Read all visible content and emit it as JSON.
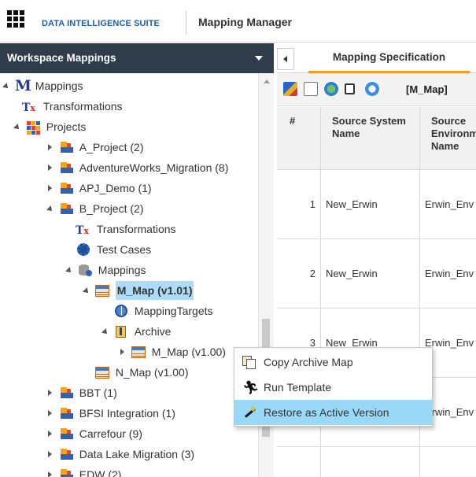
{
  "header": {
    "brand": "DATA INTELLIGENCE SUITE",
    "title": "Mapping Manager",
    "icons": {
      "app_menu": "waffle-grid-icon"
    }
  },
  "left_panel": {
    "title": "Workspace Mappings",
    "tree": [
      {
        "label": "Mappings",
        "icon": "mappings-root-icon",
        "state": "expanded"
      },
      {
        "label": "Transformations",
        "icon": "transformations-icon",
        "state": "leaf"
      },
      {
        "label": "Projects",
        "icon": "projects-grid-icon",
        "state": "expanded"
      },
      {
        "label": "A_Project (2)",
        "icon": "project-icon",
        "state": "collapsed"
      },
      {
        "label": "AdventureWorks_Migration (8)",
        "icon": "project-icon",
        "state": "collapsed"
      },
      {
        "label": "APJ_Demo (1)",
        "icon": "project-icon",
        "state": "collapsed"
      },
      {
        "label": "B_Project (2)",
        "icon": "project-icon",
        "state": "expanded"
      },
      {
        "label": "Transformations",
        "icon": "transformations-icon",
        "state": "leaf"
      },
      {
        "label": "Test Cases",
        "icon": "test-cases-icon",
        "state": "leaf"
      },
      {
        "label": "Mappings",
        "icon": "mappings-db-icon",
        "state": "expanded"
      },
      {
        "label": "M_Map (v1.01)",
        "icon": "map-table-icon",
        "state": "expanded",
        "selected": true
      },
      {
        "label": "MappingTargets",
        "icon": "mapping-targets-icon",
        "state": "leaf"
      },
      {
        "label": "Archive",
        "icon": "archive-icon",
        "state": "expanded"
      },
      {
        "label": "M_Map (v1.00)",
        "icon": "map-table-icon",
        "state": "collapsed"
      },
      {
        "label": "N_Map (v1.00)",
        "icon": "map-table-icon",
        "state": "leaf"
      },
      {
        "label": "BBT (1)",
        "icon": "project-icon",
        "state": "collapsed"
      },
      {
        "label": "BFSI Integration (1)",
        "icon": "project-icon",
        "state": "collapsed"
      },
      {
        "label": "Carrefour (9)",
        "icon": "project-icon",
        "state": "collapsed"
      },
      {
        "label": "Data Lake Migration (3)",
        "icon": "project-icon",
        "state": "collapsed"
      },
      {
        "label": "EDW (2)",
        "icon": "project-icon",
        "state": "collapsed"
      }
    ]
  },
  "right_panel": {
    "tab": "Mapping Specification",
    "toolbar_label": "[M_Map]",
    "toolbar_icons": [
      "edit-icon",
      "export-icon",
      "sync-icon",
      "document-icon",
      "refresh-icon"
    ],
    "columns": [
      "#",
      "Source System Name",
      "Source Environment Name"
    ],
    "rows": [
      {
        "num": "1",
        "source_system": "New_Erwin",
        "source_env": "Erwin_Env"
      },
      {
        "num": "2",
        "source_system": "New_Erwin",
        "source_env": "Erwin_Env"
      },
      {
        "num": "3",
        "source_system": "New_Erwin",
        "source_env": "Erwin_Env"
      },
      {
        "num": "",
        "source_system": "",
        "source_env": "Erwin_Env"
      }
    ]
  },
  "context_menu": {
    "items": [
      {
        "label": "Copy Archive Map",
        "icon": "copy-icon"
      },
      {
        "label": "Run Template",
        "icon": "run-icon"
      },
      {
        "label": "Restore as Active Version",
        "icon": "magic-wand-icon",
        "highlighted": true
      }
    ]
  },
  "colors": {
    "panel_header": "#2f3d4a",
    "brand_blue": "#1f5fa8",
    "tab_accent": "#f59a23",
    "selection": "#aedcf7",
    "menu_highlight": "#99d8f6"
  }
}
